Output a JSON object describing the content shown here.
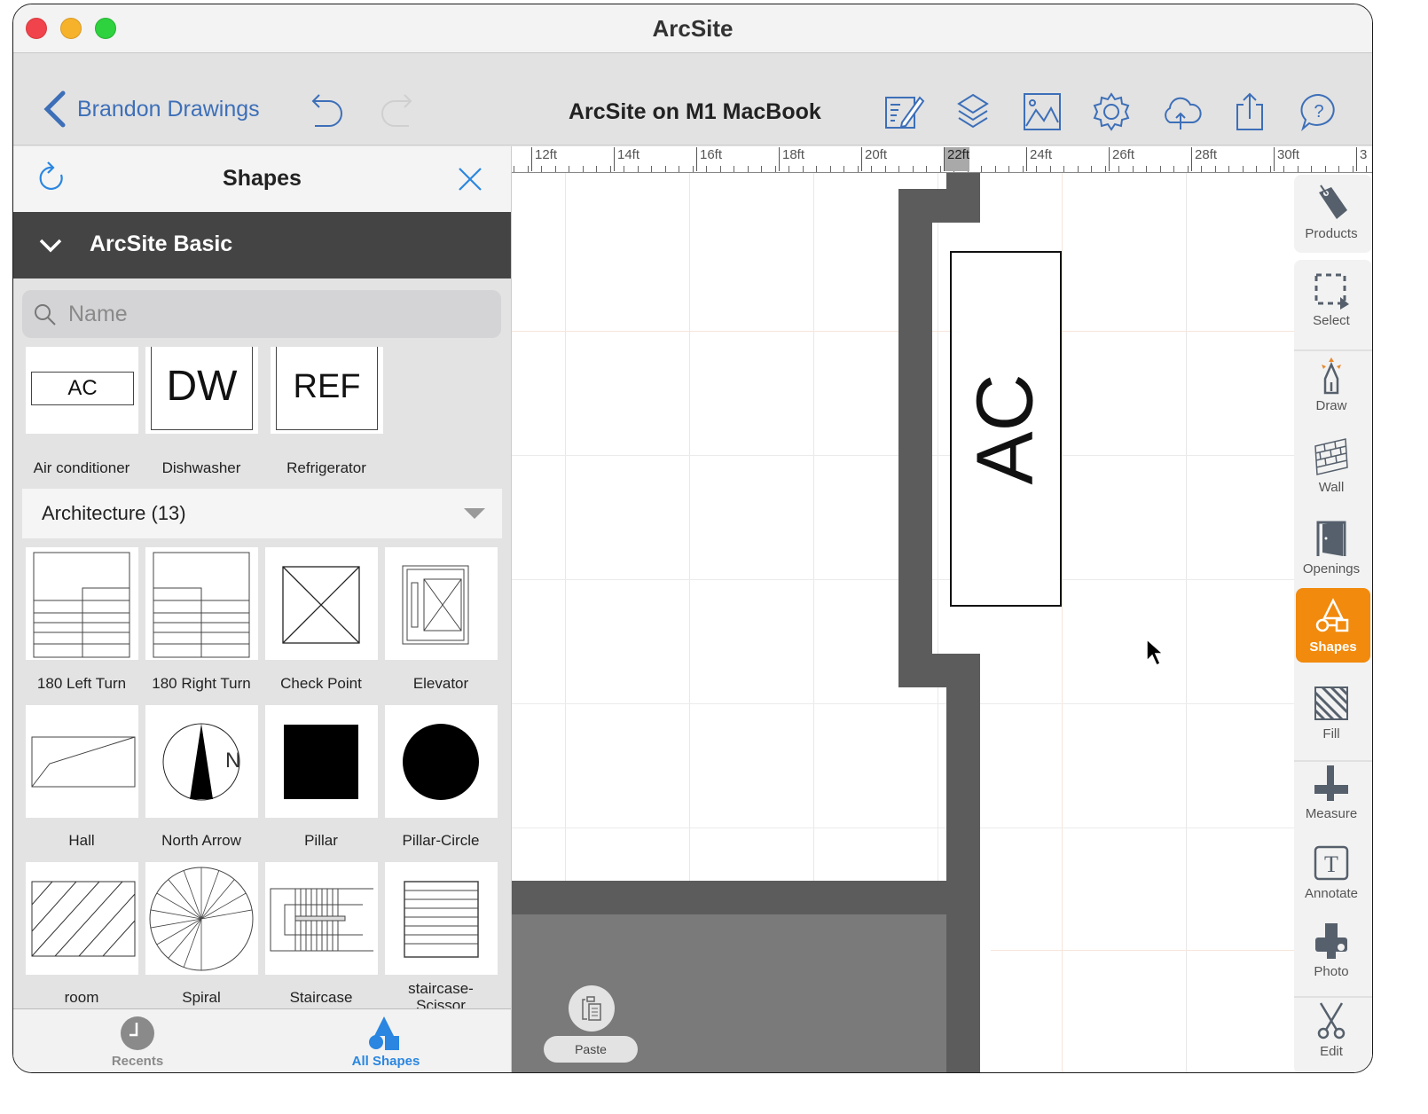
{
  "window": {
    "app_title": "ArcSite",
    "controls": [
      "close",
      "minimize",
      "zoom"
    ]
  },
  "toolbar": {
    "back_label": "Brandon Drawings",
    "document_title": "ArcSite on M1 MacBook",
    "icons": [
      "edit-notes-icon",
      "layers-icon",
      "image-icon",
      "settings-gear-icon",
      "cloud-upload-icon",
      "share-icon",
      "help-icon"
    ],
    "undo_enabled": true,
    "redo_enabled": false
  },
  "shapes_panel": {
    "title": "Shapes",
    "library_name": "ArcSite Basic",
    "search_placeholder": "Name",
    "search_value": "",
    "appliance_items": [
      {
        "label": "Air conditioner",
        "glyph": "AC"
      },
      {
        "label": "Dishwasher",
        "glyph": "DW"
      },
      {
        "label": "Refrigerator",
        "glyph": "REF"
      }
    ],
    "category": {
      "label": "Architecture (13)"
    },
    "architecture_items": [
      {
        "label": "180 Left Turn"
      },
      {
        "label": "180 Right Turn"
      },
      {
        "label": "Check Point"
      },
      {
        "label": "Elevator"
      },
      {
        "label": "Hall"
      },
      {
        "label": "North Arrow"
      },
      {
        "label": "Pillar"
      },
      {
        "label": "Pillar-Circle"
      },
      {
        "label": "room"
      },
      {
        "label": "Spiral"
      },
      {
        "label": "Staircase"
      },
      {
        "label": "staircase-Scissor"
      }
    ],
    "north_letter": "N",
    "bottom_tabs": [
      {
        "label": "Recents",
        "active": false
      },
      {
        "label": "All Shapes",
        "active": true
      }
    ]
  },
  "canvas": {
    "ruler_labels": [
      "12ft",
      "14ft",
      "16ft",
      "18ft",
      "20ft",
      "22ft",
      "24ft",
      "26ft",
      "28ft",
      "30ft",
      "3"
    ],
    "ruler_active": "22ft",
    "placed_shape_text": "AC",
    "paste_label": "Paste"
  },
  "tool_rail": {
    "tools": [
      {
        "id": "products",
        "label": "Products"
      },
      {
        "id": "select",
        "label": "Select"
      },
      {
        "id": "draw",
        "label": "Draw"
      },
      {
        "id": "wall",
        "label": "Wall"
      },
      {
        "id": "openings",
        "label": "Openings"
      },
      {
        "id": "shapes",
        "label": "Shapes",
        "active": true
      },
      {
        "id": "fill",
        "label": "Fill"
      },
      {
        "id": "measure",
        "label": "Measure"
      },
      {
        "id": "annotate",
        "label": "Annotate"
      },
      {
        "id": "photo",
        "label": "Photo"
      },
      {
        "id": "edit",
        "label": "Edit"
      }
    ]
  },
  "colors": {
    "accent_blue": "#3d6fb8",
    "active_orange": "#f18a0d",
    "wall_gray": "#5c5c5c",
    "library_bar": "#444444"
  }
}
